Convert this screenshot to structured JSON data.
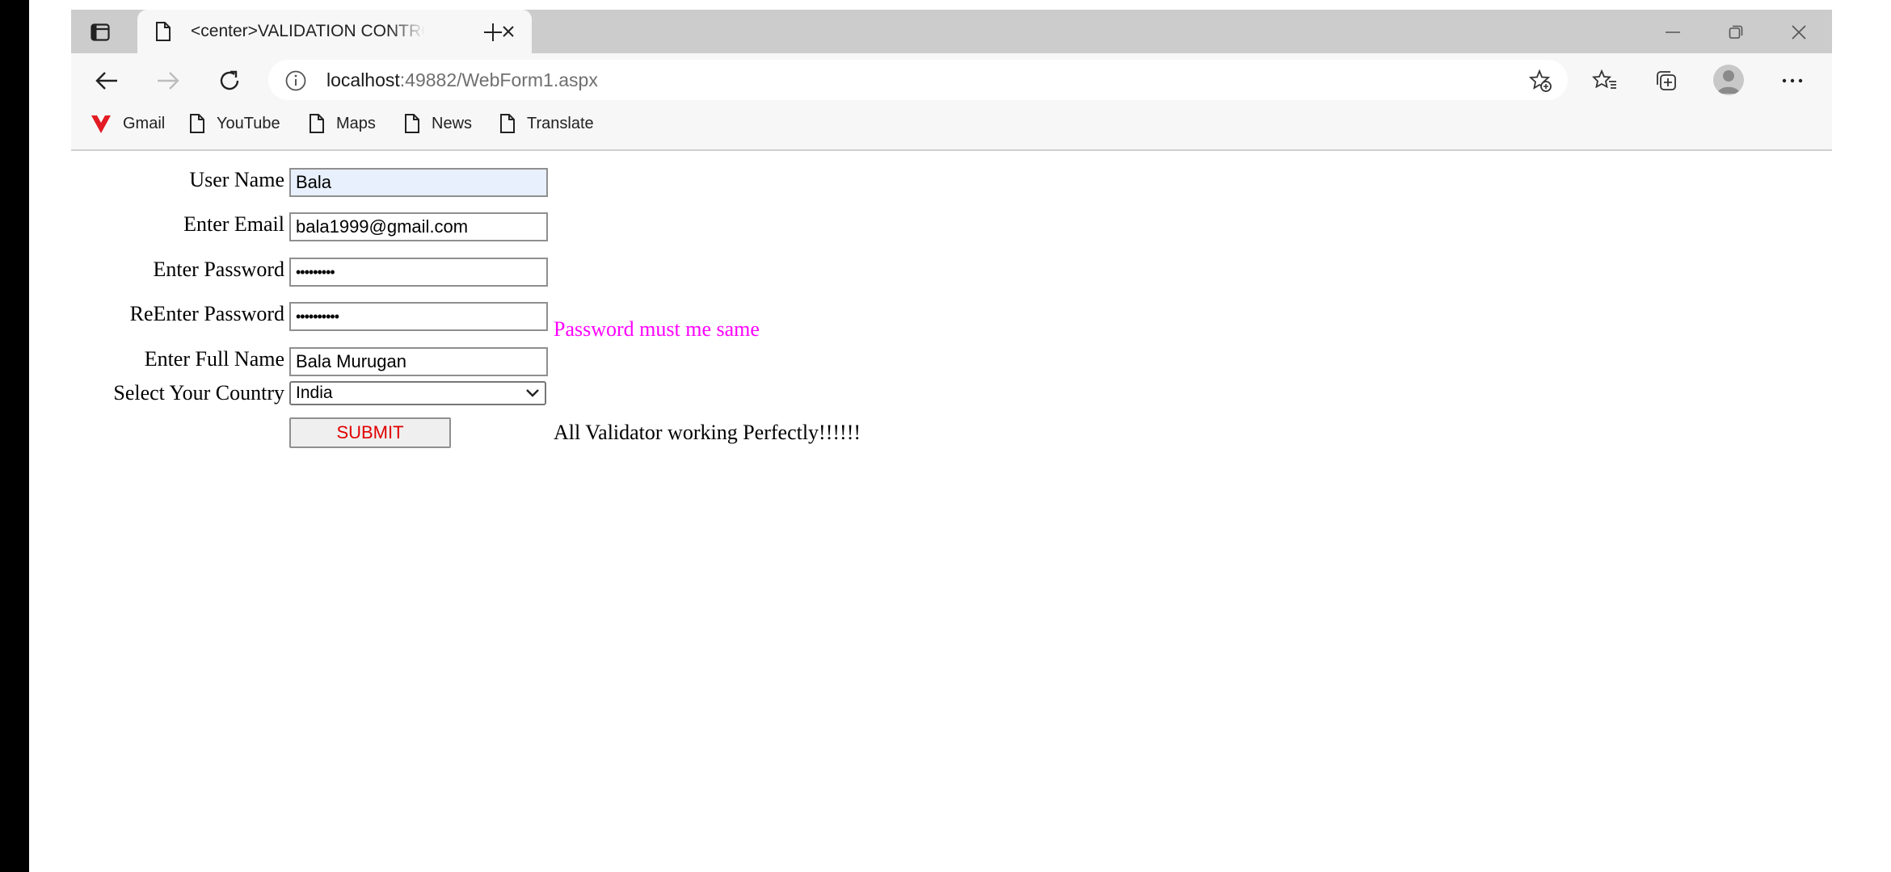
{
  "browser": {
    "tab_title": "<center>VALIDATION CONTROLS</center>",
    "address": {
      "host": "localhost",
      "rest": ":49882/WebForm1.aspx"
    },
    "bookmarks": [
      "Gmail",
      "YouTube",
      "Maps",
      "News",
      "Translate"
    ]
  },
  "form": {
    "username_label": "User Name",
    "username_value": "Bala",
    "email_label": "Enter Email",
    "email_value": "bala1999@gmail.com",
    "password_label": "Enter Password",
    "password_value": "•••••••••",
    "repassword_label": "ReEnter Password",
    "repassword_value": "••••••••••",
    "password_error": "Password must me same",
    "fullname_label": "Enter Full Name",
    "fullname_value": "Bala Murugan",
    "country_label": "Select Your Country",
    "country_value": "India",
    "submit_label": "SUBMIT",
    "result_message": "All Validator working Perfectly!!!!!!"
  },
  "colors": {
    "error_text": "#ff00ff",
    "submit_text": "#e00000",
    "autofill_bg": "#e8f0fe"
  }
}
